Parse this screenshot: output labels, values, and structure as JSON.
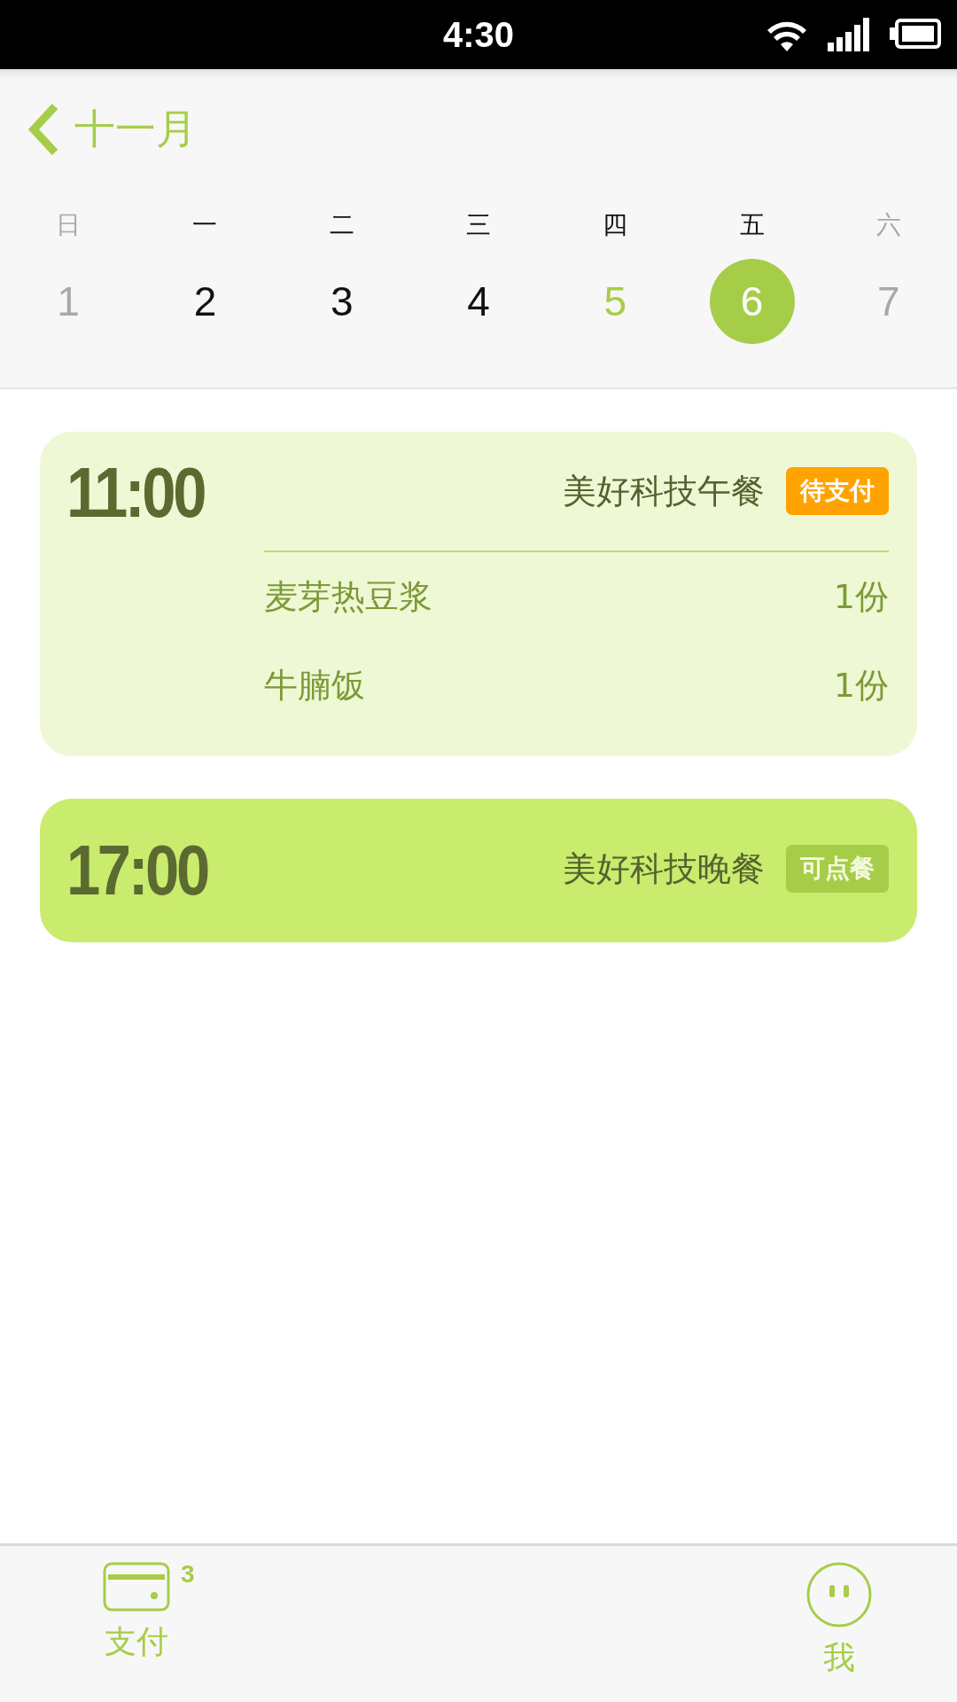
{
  "status_bar": {
    "time": "4:30"
  },
  "header": {
    "month": "十一月"
  },
  "days": [
    {
      "weekday": "日",
      "day": "1",
      "kind": "weekend",
      "selected": false
    },
    {
      "weekday": "一",
      "day": "2",
      "kind": "weekday",
      "selected": false
    },
    {
      "weekday": "二",
      "day": "3",
      "kind": "weekday",
      "selected": false
    },
    {
      "weekday": "三",
      "day": "4",
      "kind": "weekday",
      "selected": false
    },
    {
      "weekday": "四",
      "day": "5",
      "kind": "today",
      "selected": false
    },
    {
      "weekday": "五",
      "day": "6",
      "kind": "weekday",
      "selected": true
    },
    {
      "weekday": "六",
      "day": "7",
      "kind": "weekend",
      "selected": false
    }
  ],
  "meals": [
    {
      "time": "11:00",
      "name": "美好科技午餐",
      "status": "待支付",
      "kind": "pending",
      "items": [
        {
          "name": "麦芽热豆浆",
          "quantity": "1份"
        },
        {
          "name": "牛腩饭",
          "quantity": "1份"
        }
      ]
    },
    {
      "time": "17:00",
      "name": "美好科技晚餐",
      "status": "可点餐",
      "kind": "open"
    }
  ],
  "tab_bar": [
    {
      "kind": "pay",
      "label": "支付",
      "badge": "3"
    },
    {
      "kind": "me",
      "label": "我"
    }
  ]
}
